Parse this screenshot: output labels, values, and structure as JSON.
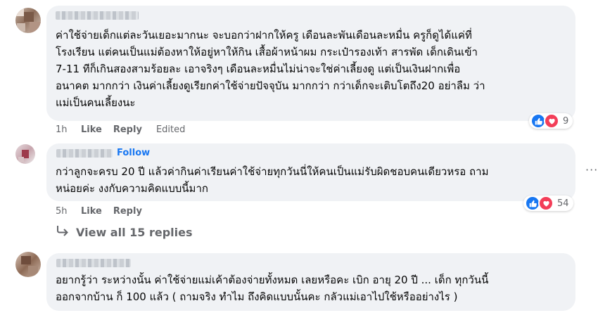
{
  "comments": [
    {
      "text_lines": [
        "ค่าใช้จ่ายเด็กแต่ละวันเยอะมากนะ จะบอกว่าฝากให้ครู เดือนละพันเดือนละหมื่น ครูก็ดูได้แค่ที่",
        "โรงเรียน แต่คนเป็นแม่ต้องหาให้อยู่หาให้กิน เสื้อผ้าหน้าผม กระเป๋ารองเท้า สารพัด เด็กเดินเข้า",
        "7-11 ทีก็เกินสองสามร้อยละ เอาจริงๆ เดือนละหมื่นไม่น่าจะใช่ค่าเลี้ยงดู แต่เป็นเงินฝากเพื่อ",
        "อนาคต มากกว่า เงินค่าเลี้ยงดูเรียกค่าใช้จ่ายปัจจุบัน มากกว่า กว่าเด็กจะเติบโตถึง20 อย่าลืม ว่า",
        "แม่เป็นคนเลี้ยงนะ"
      ],
      "time": "1h",
      "like_label": "Like",
      "reply_label": "Reply",
      "edited_label": "Edited",
      "reaction_count": "9"
    },
    {
      "follow_label": "Follow",
      "text_lines": [
        "กว่าลูกจะครบ 20 ปี แล้วค่ากินค่าเรียนค่าใช้จ่ายทุกวันนี่ให้คนเป็นแม่รับผิดชอบคนเดียวหรอ ถาม",
        "หน่อยค่ะ งงกับความคิดแบบนี้มาก"
      ],
      "time": "5h",
      "like_label": "Like",
      "reply_label": "Reply",
      "reaction_count": "54",
      "more_label": "···"
    },
    {
      "text_lines": [
        "อยากรู้ว่า ระหว่างนั้น ค่าใช้จ่ายแม่เค้าต้องจ่ายทั้งหมด เลยหรือคะ เบิก อายุ 20 ปี ... เด็ก ทุกวันนี้",
        "ออกจากบ้าน ก็ 100 แล้ว ( ถามจริง ทำไม ถึงคิดแบบนั้นคะ กลัวแม่เอาไปใช้หรืออย่างไร )"
      ]
    }
  ],
  "view_replies_label": "View all 15 replies",
  "colors": {
    "bubble": "#f0f2f5",
    "link": "#1877f2",
    "muted": "#65676b",
    "like": "#1877f2",
    "love": "#f33e58"
  }
}
